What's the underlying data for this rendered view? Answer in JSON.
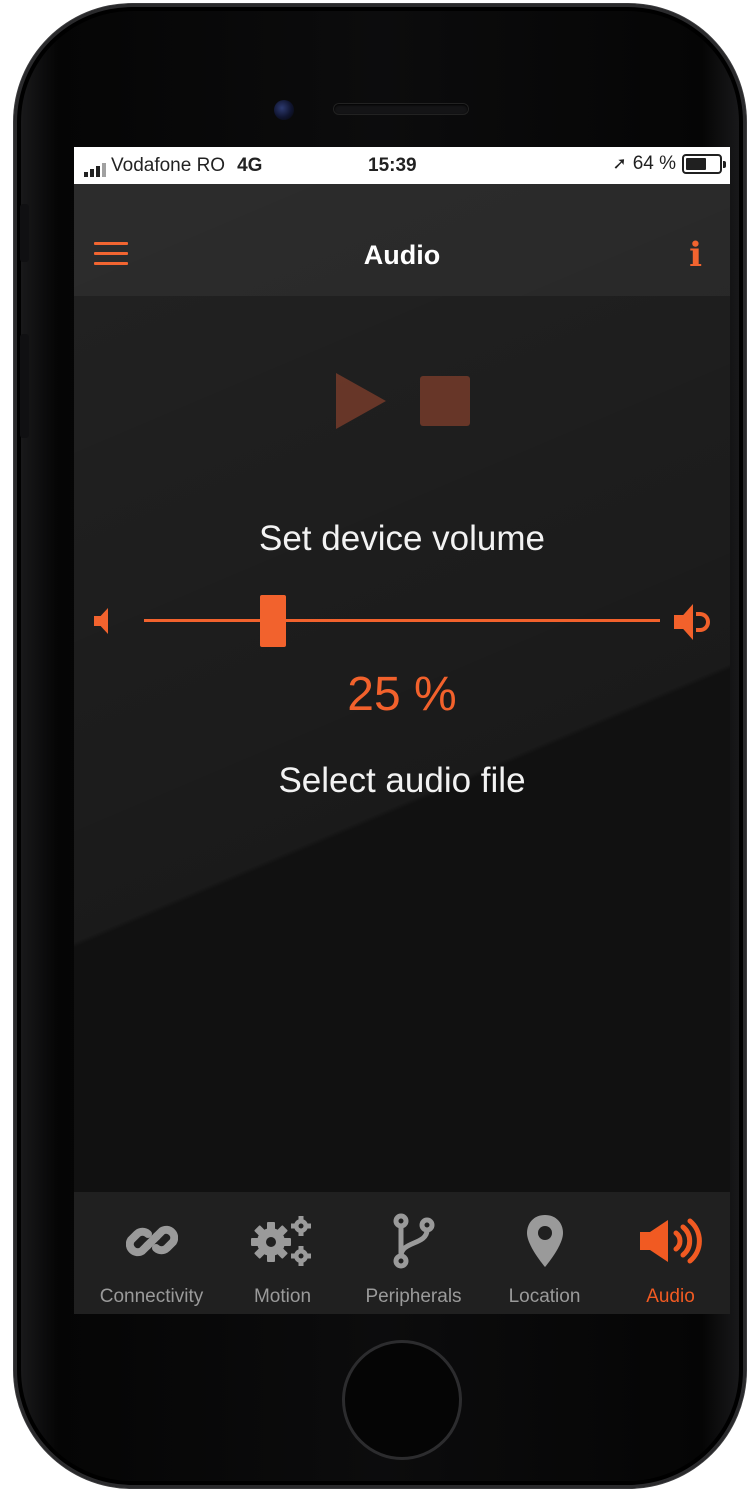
{
  "status_bar": {
    "carrier": "Vodafone RO",
    "network": "4G",
    "time": "15:39",
    "location_glyph": "➚",
    "battery": "64 %",
    "battery_level": 0.64
  },
  "header": {
    "title": "Audio",
    "menu_icon": "hamburger-menu-icon",
    "info_icon": "info-icon",
    "info_glyph": "i"
  },
  "player": {
    "play_icon": "play-icon",
    "stop_icon": "stop-icon"
  },
  "volume": {
    "label": "Set device volume",
    "value_text": "25 %",
    "value": 0.25,
    "low_icon": "speaker-low-icon",
    "high_icon": "speaker-high-icon"
  },
  "audio_file": {
    "label": "Select audio file"
  },
  "tabbar": {
    "tabs": [
      {
        "label": "Connectivity",
        "icon": "link-icon",
        "active": false
      },
      {
        "label": "Motion",
        "icon": "gears-icon",
        "active": false
      },
      {
        "label": "Peripherals",
        "icon": "branch-icon",
        "active": false
      },
      {
        "label": "Location",
        "icon": "map-pin-icon",
        "active": false
      },
      {
        "label": "Audio",
        "icon": "speaker-icon",
        "active": true
      }
    ]
  },
  "colors": {
    "accent": "#f15a22",
    "accent_dim": "#5e2a1b",
    "background": "#111111",
    "bar": "#1c1c1c",
    "inactive": "#9a9a9a"
  }
}
